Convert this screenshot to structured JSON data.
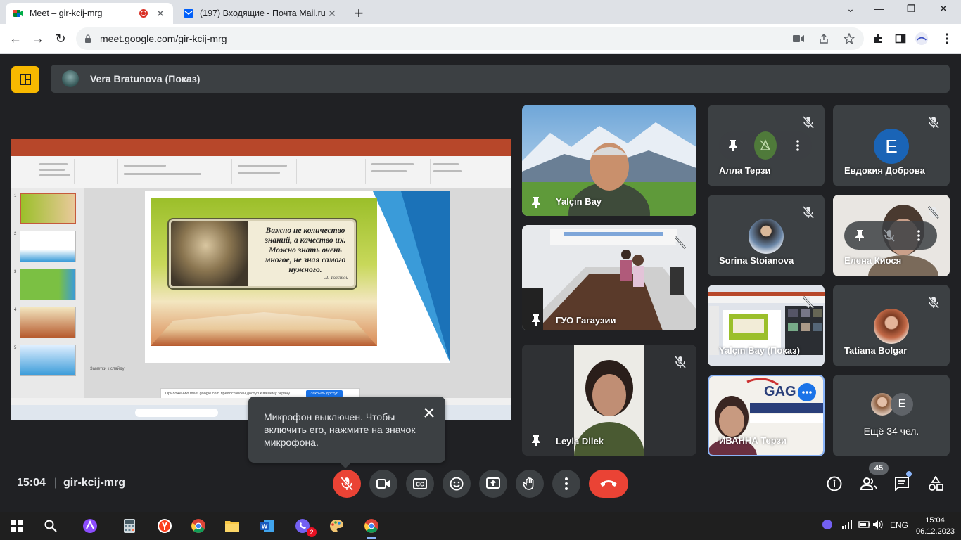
{
  "browser": {
    "tabs": [
      {
        "title": "Meet – gir-kcij-mrg",
        "active": true
      },
      {
        "title": "(197) Входящие - Почта Mail.ru",
        "active": false
      }
    ],
    "url": "meet.google.com/gir-kcij-mrg"
  },
  "meet": {
    "presenter_label": "Vera Bratunova (Показ)",
    "shared_slide": {
      "quote": "Важно не количество знаний, а качество их. Можно знать очень многое, не зная самого нужного.",
      "author": "Л. Толстой",
      "notes_placeholder": "Заметки к слайду",
      "permission_bar_text": "Приложению meet.google.com предоставлен доступ к вашему экрану.",
      "permission_bar_button": "Закрыть доступ"
    },
    "tiles": [
      {
        "name": "Yalçın Bay"
      },
      {
        "name": "Алла Терзи"
      },
      {
        "name": "Евдокия Доброва",
        "avatar_letter": "E"
      },
      {
        "name": "ГУО Гагаузии"
      },
      {
        "name": "Sorina Stoianova"
      },
      {
        "name": "Елена Киося"
      },
      {
        "name": "Leyla Dilek"
      },
      {
        "name": "Yalçın Bay (Показ)"
      },
      {
        "name": "Tatiana Bolgar"
      },
      {
        "name": "ИВАННА Терзи"
      },
      {
        "name": "Ещё 34 чел.",
        "avatar_letter": "E"
      }
    ],
    "toast": {
      "text": "Микрофон выключен. Чтобы включить его, нажмите на значок микрофона."
    },
    "bottom": {
      "time": "15:04",
      "separator": "|",
      "meeting_code": "gir-kcij-mrg",
      "participants_count": "45"
    }
  },
  "taskbar": {
    "language": "ENG",
    "time": "15:04",
    "date": "06.12.2023",
    "viber_badge": "2"
  },
  "colors": {
    "accent_red": "#ea4335",
    "meet_yellow": "#f8b900",
    "tile_bg": "#3c4043",
    "page_bg": "#202124"
  }
}
